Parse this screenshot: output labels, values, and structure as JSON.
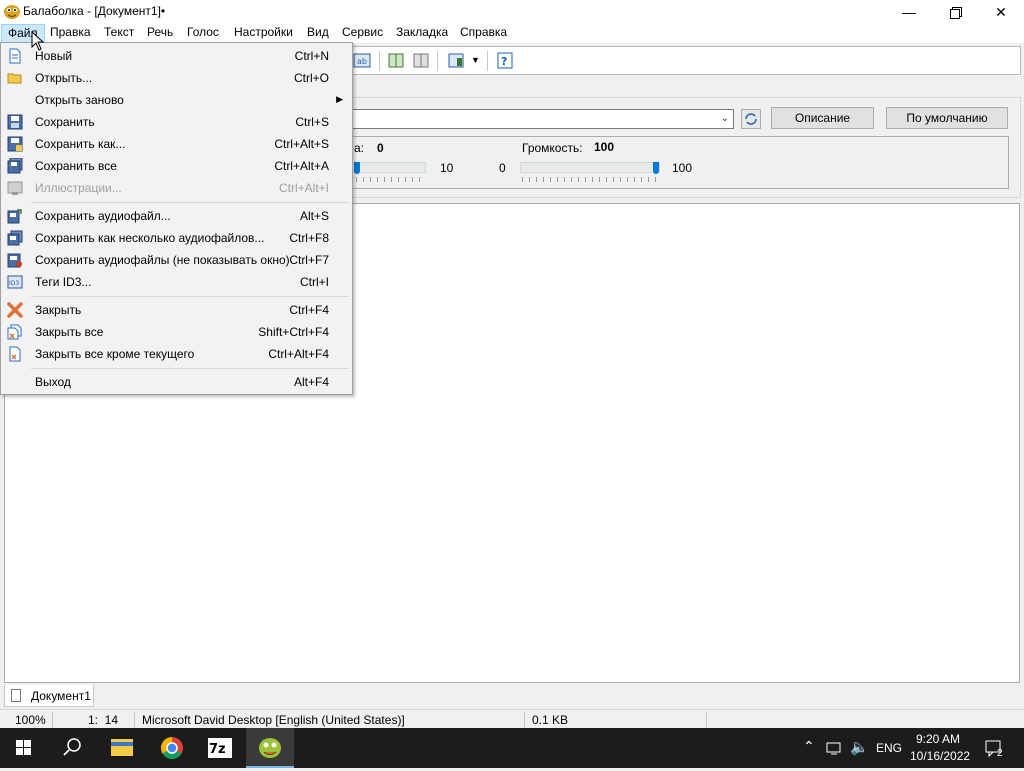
{
  "window": {
    "title": "Балаболка - [Документ1]•"
  },
  "menubar": {
    "items": [
      "Файл",
      "Правка",
      "Текст",
      "Речь",
      "Голос",
      "Настройки",
      "Вид",
      "Сервис",
      "Закладка",
      "Справка"
    ]
  },
  "file_menu": {
    "items": [
      {
        "label": "Новый",
        "shortcut": "Ctrl+N",
        "icon": "new-document-icon"
      },
      {
        "label": "Открыть...",
        "shortcut": "Ctrl+O",
        "icon": "open-folder-icon"
      },
      {
        "label": "Открыть заново",
        "shortcut": "",
        "icon": ""
      },
      {
        "label": "Сохранить",
        "shortcut": "Ctrl+S",
        "icon": "save-icon"
      },
      {
        "label": "Сохранить как...",
        "shortcut": "Ctrl+Alt+S",
        "icon": "save-as-icon"
      },
      {
        "label": "Сохранить все",
        "shortcut": "Ctrl+Alt+A",
        "icon": "save-all-icon"
      },
      {
        "label": "Иллюстрации...",
        "shortcut": "Ctrl+Alt+I",
        "icon": "illustrations-icon"
      },
      {
        "label": "Сохранить аудиофайл...",
        "shortcut": "Alt+S",
        "icon": "save-audio-icon"
      },
      {
        "label": "Сохранить как несколько аудиофайлов...",
        "shortcut": "Ctrl+F8",
        "icon": "save-multiple-audio-icon"
      },
      {
        "label": "Сохранить аудиофайлы (не показывать окно)",
        "shortcut": "Ctrl+F7",
        "icon": "save-audio-silent-icon"
      },
      {
        "label": "Теги ID3...",
        "shortcut": "Ctrl+I",
        "icon": "id3-tags-icon"
      },
      {
        "label": "Закрыть",
        "shortcut": "Ctrl+F4",
        "icon": "close-icon"
      },
      {
        "label": "Закрыть все",
        "shortcut": "Shift+Ctrl+F4",
        "icon": "close-all-icon"
      },
      {
        "label": "Закрыть все кроме текущего",
        "shortcut": "Ctrl+Alt+F4",
        "icon": "close-others-icon"
      },
      {
        "label": "Выход",
        "shortcut": "Alt+F4",
        "icon": ""
      }
    ]
  },
  "voice_panel": {
    "buttons": {
      "description": "Описание",
      "default": "По умолчанию"
    },
    "rate_label_partial": "а:",
    "rate_value": "0",
    "rate_max": "10",
    "volume_label": "Громкость:",
    "volume_value": "100",
    "volume_min": "0",
    "volume_max": "100",
    "volume_level_fraction": 1.0
  },
  "document_tab": {
    "label": "Документ1"
  },
  "statusbar": {
    "zoom": "100%",
    "position": "1:  14",
    "voice": "Microsoft David Desktop [English (United States)]",
    "size": "0.1 KB"
  },
  "taskbar": {
    "language": "ENG",
    "time": "9:20 AM",
    "date": "10/16/2022",
    "notifications": "2"
  }
}
